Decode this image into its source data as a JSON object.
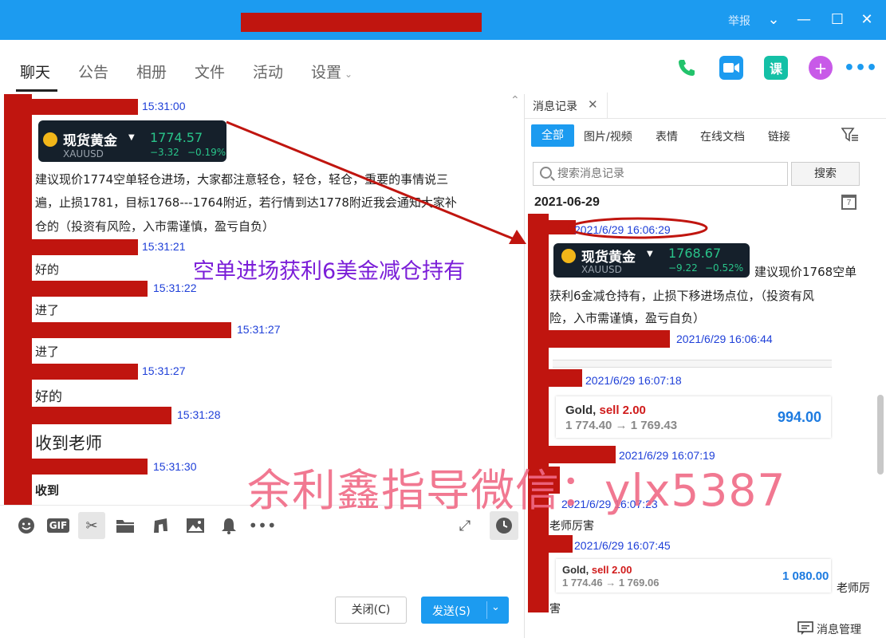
{
  "titlebar": {
    "report": "举报",
    "minimize": "—",
    "maximize": "☐",
    "close": "✕",
    "dropdown": "⌄"
  },
  "nav": {
    "tabs": [
      {
        "label": "聊天"
      },
      {
        "label": "公告"
      },
      {
        "label": "相册"
      },
      {
        "label": "文件"
      },
      {
        "label": "活动"
      },
      {
        "label": "设置"
      }
    ],
    "lesson_icon": "课",
    "colors": {
      "phone": "#22c36b",
      "video": "#1c9bf0",
      "lesson": "#14c0a6",
      "plus": "#c85ae8"
    }
  },
  "chat": {
    "times": [
      "15:31:00",
      "15:31:21",
      "15:31:22",
      "15:31:27",
      "15:31:27",
      "15:31:28",
      "15:31:30"
    ],
    "quote": {
      "name": "现货黄金",
      "symbol": "XAUUSD",
      "price": "1774.57",
      "change": "−3.32",
      "percent": "−0.19%"
    },
    "message_main": [
      "建议现价1774空单轻仓进场，大家都注意轻仓，轻仓，轻仓，重要的事情说三",
      "遍，止损1781，目标1768---1764附近，若行情到达1778附近我会通知大家补",
      "仓的（投资有风险，入市需谨慎，盈亏自负）"
    ],
    "replies": [
      "好的",
      "进了",
      "进了",
      "好的",
      "收到老师",
      "收到"
    ],
    "overlay": "空单进场获利6美金减仓持有",
    "watermark": "余利鑫指导微信：ylx5387"
  },
  "toolbar": {
    "gif": "GIF",
    "close_label": "关闭(C)",
    "send_label": "发送(S)"
  },
  "history": {
    "tab": "消息记录",
    "filters": [
      "全部",
      "图片/视频",
      "表情",
      "在线文档",
      "链接"
    ],
    "search_placeholder": "搜索消息记录",
    "search_button": "搜索",
    "date": "2021-06-29",
    "calendar_day": "7",
    "times": [
      "2021/6/29 16:06:29",
      "2021/6/29 16:06:44",
      "2021/6/29 16:07:18",
      "2021/6/29 16:07:19",
      "2021/6/29 16:07:23",
      "2021/6/29 16:07:45"
    ],
    "quote": {
      "name": "现货黄金",
      "symbol": "XAUUSD",
      "price": "1768.67",
      "change": "−9.22",
      "percent": "−0.52%"
    },
    "message_inline": "建议现价1768空单",
    "message_lines": [
      "获利6金减仓持有，止损下移进场点位，（投资有风",
      "险，入市需谨慎，盈亏自负）"
    ],
    "trade1": {
      "name": "Gold, ",
      "side": "sell 2.00",
      "path": "1 774.40 → 1 769.43",
      "profit": "994.00"
    },
    "trade2": {
      "name": "Gold, ",
      "side": "sell 2.00",
      "path": "1 774.46 → 1 769.06",
      "profit": "1 080.00"
    },
    "reply1": "老师厉害",
    "reply2_a": "老师厉",
    "reply2_b": "害",
    "manage": "消息管理"
  }
}
